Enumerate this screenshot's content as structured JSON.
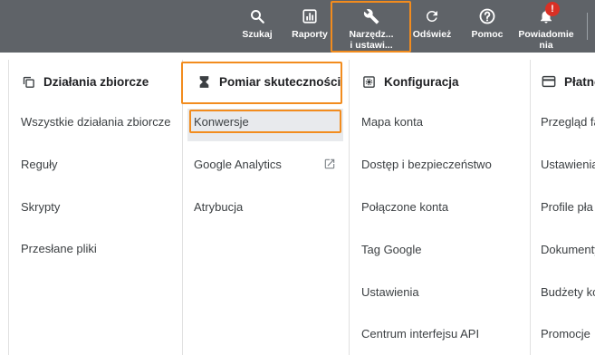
{
  "toolbar": {
    "search_label": "Szukaj",
    "reports_label": "Raporty",
    "tools_label_line1": "Narzędz...",
    "tools_label_line2": "i ustawi...",
    "refresh_label": "Odśwież",
    "help_label": "Pomoc",
    "notifications_label_line1": "Powiadomie",
    "notifications_label_line2": "nia",
    "notifications_badge": "!"
  },
  "menu": {
    "bulk": {
      "title": "Działania zbiorcze",
      "items": [
        "Wszystkie działania zbiorcze",
        "Reguły",
        "Skrypty",
        "Przesłane pliki"
      ]
    },
    "measurement": {
      "title": "Pomiar skuteczności",
      "items": [
        "Konwersje",
        "Google Analytics",
        "Atrybucja"
      ],
      "active": "Konwersje"
    },
    "configuration": {
      "title": "Konfiguracja",
      "items": [
        "Mapa konta",
        "Dostęp i bezpieczeństwo",
        "Połączone konta",
        "Tag Google",
        "Ustawienia",
        "Centrum interfejsu API"
      ]
    },
    "billing": {
      "title": "Płatno",
      "items": [
        "Przegląd fa",
        "Ustawienia",
        "Profile pła",
        "Dokumenty",
        "Budżety ko",
        "Promocje"
      ]
    }
  },
  "colors": {
    "toolbar_bg": "#5f6368",
    "highlight": "#f28c1e",
    "badge": "#d93025",
    "active_item_bg": "#e8eaed"
  }
}
